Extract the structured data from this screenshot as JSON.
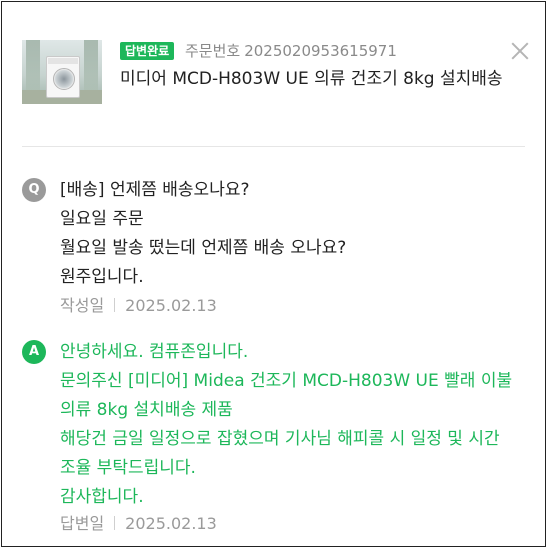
{
  "header": {
    "badge": "답변완료",
    "order_label": "주문번호",
    "order_number": "2025020953615971",
    "product_title": "미디어 MCD-H803W UE 의류 건조기 8kg 설치배송",
    "close_icon": "close-icon"
  },
  "question": {
    "marker": "Q",
    "lines": [
      "[배송] 언제쯤 배송오나요?",
      "일요일 주문",
      "월요일 발송 떴는데 언제쯤 배송 오나요?",
      "원주입니다."
    ],
    "date_label": "작성일",
    "date": "2025.02.13"
  },
  "answer": {
    "marker": "A",
    "lines": [
      "안녕하세요. 컴퓨존입니다.",
      "문의주신 [미디어] Midea 건조기 MCD-H803W UE 빨래 이불",
      "의류 8kg 설치배송 제품",
      "해당건 금일 일정으로 잡혔으며 기사님 해피콜 시 일정 및 시간",
      "조율 부탁드립니다.",
      "감사합니다."
    ],
    "date_label": "답변일",
    "date": "2025.02.13"
  },
  "colors": {
    "accent": "#1db75a",
    "muted": "#9a9a9a"
  }
}
